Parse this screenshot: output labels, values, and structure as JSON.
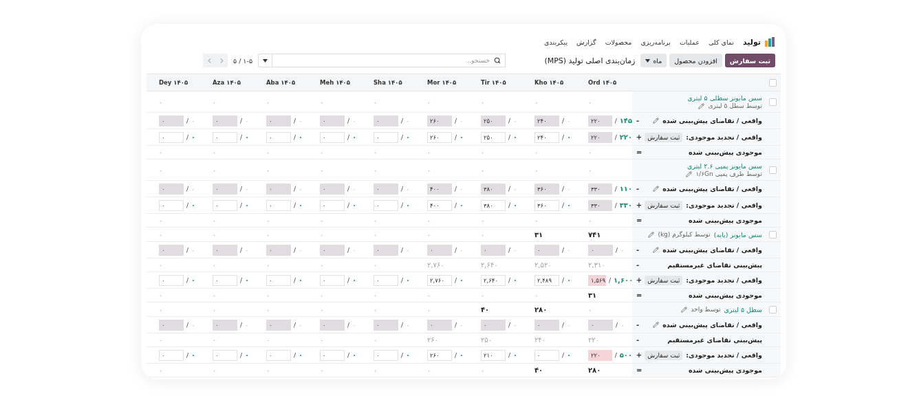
{
  "app": {
    "name": "تولید",
    "menu": [
      "نمای کلی",
      "عملیات",
      "برنامه‌ریزی",
      "محصولات",
      "گزارش",
      "پیکربندی"
    ]
  },
  "toolbar": {
    "buttons": [
      {
        "label": "ثبت سفارش",
        "kind": "primary"
      },
      {
        "label": "افزودن محصول",
        "kind": "secondary"
      }
    ],
    "period": "ماه",
    "title": "زمان‌بندی اصلی تولید (MPS)",
    "search": {
      "placeholder": "جستجو..."
    },
    "pager": "۱-۵ / ۵"
  },
  "table": {
    "select_all": {
      "checked": false
    },
    "columns": [
      "Ord ۱۴۰۵",
      "Kho ۱۴۰۵",
      "Tir ۱۴۰۵",
      "Mor ۱۴۰۵",
      "Sha ۱۴۰۵",
      "Meh ۱۴۰۵",
      "Aba ۱۴۰۵",
      "Aza ۱۴۰۵",
      "Dey ۱۴۰۵"
    ],
    "rows": [
      {
        "kind": "product_stacked",
        "checked": false,
        "name": "سس مایونز سطلی ۵ لیتری",
        "sub": "توسط سطل ۵ لیتری",
        "cells": [
          {
            "text": "۰",
            "highlighted": false
          },
          {
            "text": "۰",
            "highlighted": false
          },
          {
            "text": "۰",
            "highlighted": false
          },
          {
            "text": "۰",
            "highlighted": false
          },
          {
            "text": "۰",
            "highlighted": false
          },
          {
            "text": "۰",
            "highlighted": false
          },
          {
            "text": "۰",
            "highlighted": false
          },
          {
            "text": "۰",
            "highlighted": false
          },
          {
            "text": "۰",
            "highlighted": false
          }
        ]
      },
      {
        "kind": "demand",
        "sign": "-",
        "label": "واقعی / تقاضای پیش‌بینی شده",
        "cells": [
          {
            "kind": "filled",
            "value": "۲۲۰",
            "sep": "/",
            "actual": "۱۴۵",
            "highlighted": true
          },
          {
            "kind": "filled",
            "value": "۲۴۰",
            "sep": "/",
            "actual": "۰",
            "highlighted": false
          },
          {
            "kind": "filled",
            "value": "۲۵۰",
            "sep": "/",
            "actual": "۰",
            "highlighted": false
          },
          {
            "kind": "filled",
            "value": "۲۶۰",
            "sep": "/",
            "actual": "۰",
            "highlighted": false
          },
          {
            "kind": "filled",
            "value": "۰",
            "sep": "/",
            "actual": "۰",
            "highlighted": false
          },
          {
            "kind": "filled",
            "value": "۰",
            "sep": "/",
            "actual": "۰",
            "highlighted": false
          },
          {
            "kind": "filled",
            "value": "۰",
            "sep": "/",
            "actual": "۰",
            "highlighted": false
          },
          {
            "kind": "filled",
            "value": "۰",
            "sep": "/",
            "actual": "۰",
            "highlighted": false
          },
          {
            "kind": "filled",
            "value": "۰",
            "sep": "/",
            "actual": "۰",
            "highlighted": false
          }
        ]
      },
      {
        "kind": "replenish",
        "sign": "+",
        "label": "واقعی / تجدید موجودی:",
        "button": "ثبت سفارش",
        "cells": [
          {
            "kind": "filled",
            "value": "۲۲۰",
            "sep": "/",
            "actual": "۲۲۰",
            "highlighted": true
          },
          {
            "kind": "input",
            "value": "۲۴۰",
            "sep": "/",
            "actual": "۰",
            "highlighted": true
          },
          {
            "kind": "input",
            "value": "۲۵۰",
            "sep": "/",
            "actual": "۰",
            "highlighted": true
          },
          {
            "kind": "input",
            "value": "۲۶۰",
            "sep": "/",
            "actual": "۰",
            "highlighted": true
          },
          {
            "kind": "input",
            "value": "۰",
            "sep": "/",
            "actual": "۰",
            "highlighted": true
          },
          {
            "kind": "input",
            "value": "۰",
            "sep": "/",
            "actual": "۰",
            "highlighted": true
          },
          {
            "kind": "input",
            "value": "۰",
            "sep": "/",
            "actual": "۰",
            "highlighted": true
          },
          {
            "kind": "input",
            "value": "۰",
            "sep": "/",
            "actual": "۰",
            "highlighted": true
          },
          {
            "kind": "input",
            "value": "۰",
            "sep": "/",
            "actual": "۰",
            "highlighted": true
          }
        ]
      },
      {
        "kind": "plain",
        "sign": "=",
        "label": "موجودی پیش‌بینی شده",
        "cells": [
          {
            "text": "۰",
            "highlighted": false
          },
          {
            "text": "۰",
            "highlighted": false
          },
          {
            "text": "۰",
            "highlighted": false
          },
          {
            "text": "۰",
            "highlighted": false
          },
          {
            "text": "۰",
            "highlighted": false
          },
          {
            "text": "۰",
            "highlighted": false
          },
          {
            "text": "۰",
            "highlighted": false
          },
          {
            "text": "۰",
            "highlighted": false
          },
          {
            "text": "۰",
            "highlighted": false
          }
        ]
      },
      {
        "kind": "product_stacked",
        "checked": false,
        "name": "سس مایونز پمپی ۲.۶ لیتری",
        "sub": "توسط ظرف پمپی ۱/۶Gn",
        "cells": [
          {
            "text": "۰",
            "highlighted": false
          },
          {
            "text": "۰",
            "highlighted": false
          },
          {
            "text": "۰",
            "highlighted": false
          },
          {
            "text": "۰",
            "highlighted": false
          },
          {
            "text": "۰",
            "highlighted": false
          },
          {
            "text": "۰",
            "highlighted": false
          },
          {
            "text": "۰",
            "highlighted": false
          },
          {
            "text": "۰",
            "highlighted": false
          },
          {
            "text": "۰",
            "highlighted": false
          }
        ]
      },
      {
        "kind": "demand",
        "sign": "-",
        "label": "واقعی / تقاضای پیش‌بینی شده",
        "cells": [
          {
            "kind": "filled",
            "value": "۳۳۰",
            "sep": "/",
            "actual": "۱۱۰",
            "highlighted": true
          },
          {
            "kind": "filled",
            "value": "۳۶۰",
            "sep": "/",
            "actual": "۰",
            "highlighted": false
          },
          {
            "kind": "filled",
            "value": "۳۸۰",
            "sep": "/",
            "actual": "۰",
            "highlighted": false
          },
          {
            "kind": "filled",
            "value": "۴۰۰",
            "sep": "/",
            "actual": "۰",
            "highlighted": false
          },
          {
            "kind": "filled",
            "value": "۰",
            "sep": "/",
            "actual": "۰",
            "highlighted": false
          },
          {
            "kind": "filled",
            "value": "۰",
            "sep": "/",
            "actual": "۰",
            "highlighted": false
          },
          {
            "kind": "filled",
            "value": "۰",
            "sep": "/",
            "actual": "۰",
            "highlighted": false
          },
          {
            "kind": "filled",
            "value": "۰",
            "sep": "/",
            "actual": "۰",
            "highlighted": false
          },
          {
            "kind": "filled",
            "value": "۰",
            "sep": "/",
            "actual": "۰",
            "highlighted": false
          }
        ]
      },
      {
        "kind": "replenish",
        "sign": "+",
        "label": "واقعی / تجدید موجودی:",
        "button": "ثبت سفارش",
        "cells": [
          {
            "kind": "filled",
            "value": "۳۳۰",
            "sep": "/",
            "actual": "۳۳۰",
            "highlighted": true
          },
          {
            "kind": "input",
            "value": "۳۶۰",
            "sep": "/",
            "actual": "۰",
            "highlighted": true
          },
          {
            "kind": "input",
            "value": "۳۸۰",
            "sep": "/",
            "actual": "۰",
            "highlighted": true
          },
          {
            "kind": "input",
            "value": "۴۰۰",
            "sep": "/",
            "actual": "۰",
            "highlighted": true
          },
          {
            "kind": "input",
            "value": "۰",
            "sep": "/",
            "actual": "۰",
            "highlighted": true
          },
          {
            "kind": "input",
            "value": "۰",
            "sep": "/",
            "actual": "۰",
            "highlighted": true
          },
          {
            "kind": "input",
            "value": "۰",
            "sep": "/",
            "actual": "۰",
            "highlighted": true
          },
          {
            "kind": "input",
            "value": "۰",
            "sep": "/",
            "actual": "۰",
            "highlighted": true
          },
          {
            "kind": "input",
            "value": "۰",
            "sep": "/",
            "actual": "۰",
            "highlighted": true
          }
        ]
      },
      {
        "kind": "plain",
        "sign": "=",
        "label": "موجودی پیش‌بینی شده",
        "cells": [
          {
            "text": "۰",
            "highlighted": false
          },
          {
            "text": "۰",
            "highlighted": false
          },
          {
            "text": "۰",
            "highlighted": false
          },
          {
            "text": "۰",
            "highlighted": false
          },
          {
            "text": "۰",
            "highlighted": false
          },
          {
            "text": "۰",
            "highlighted": false
          },
          {
            "text": "۰",
            "highlighted": false
          },
          {
            "text": "۰",
            "highlighted": false
          },
          {
            "text": "۰",
            "highlighted": false
          }
        ]
      },
      {
        "kind": "product_inline",
        "checked": false,
        "name": "سس مایونز (پایه)",
        "sub": "توسط کیلوگرم (kg)",
        "cells": [
          {
            "text": "۷۴۱",
            "highlighted": true
          },
          {
            "text": "۳۱",
            "highlighted": true
          },
          {
            "text": "۰",
            "highlighted": false
          },
          {
            "text": "۰",
            "highlighted": false
          },
          {
            "text": "۰",
            "highlighted": false
          },
          {
            "text": "۰",
            "highlighted": false
          },
          {
            "text": "۰",
            "highlighted": false
          },
          {
            "text": "۰",
            "highlighted": false
          },
          {
            "text": "۰",
            "highlighted": false
          }
        ]
      },
      {
        "kind": "demand",
        "sign": "-",
        "label": "واقعی / تقاضای پیش‌بینی شده",
        "cells": [
          {
            "kind": "filled",
            "value": "۰",
            "sep": "/",
            "actual": "۰",
            "highlighted": false
          },
          {
            "kind": "filled",
            "value": "۰",
            "sep": "/",
            "actual": "۰",
            "highlighted": false
          },
          {
            "kind": "filled",
            "value": "۰",
            "sep": "/",
            "actual": "۰",
            "highlighted": false
          },
          {
            "kind": "filled",
            "value": "۰",
            "sep": "/",
            "actual": "۰",
            "highlighted": false
          },
          {
            "kind": "filled",
            "value": "۰",
            "sep": "/",
            "actual": "۰",
            "highlighted": false
          },
          {
            "kind": "filled",
            "value": "۰",
            "sep": "/",
            "actual": "۰",
            "highlighted": false
          },
          {
            "kind": "filled",
            "value": "۰",
            "sep": "/",
            "actual": "۰",
            "highlighted": false
          },
          {
            "kind": "filled",
            "value": "۰",
            "sep": "/",
            "actual": "۰",
            "highlighted": false
          },
          {
            "kind": "filled",
            "value": "۰",
            "sep": "/",
            "actual": "۰",
            "highlighted": false
          }
        ]
      },
      {
        "kind": "plain",
        "sign": "-",
        "label": "پیش‌بینی تقاضای غیرمستقیم",
        "cells": [
          {
            "text": "۲,۳۱۰",
            "highlighted": false
          },
          {
            "text": "۲,۵۲۰",
            "highlighted": false
          },
          {
            "text": "۲,۶۴۰",
            "highlighted": false
          },
          {
            "text": "۲,۷۶۰",
            "highlighted": false
          },
          {
            "text": "۰",
            "highlighted": false
          },
          {
            "text": "۰",
            "highlighted": false
          },
          {
            "text": "۰",
            "highlighted": false
          },
          {
            "text": "۰",
            "highlighted": false
          },
          {
            "text": "۰",
            "highlighted": false
          }
        ]
      },
      {
        "kind": "replenish",
        "sign": "+",
        "label": "واقعی / تجدید موجودی:",
        "button": "ثبت سفارش",
        "cells": [
          {
            "kind": "warning",
            "value": "۱,۵۶۹",
            "sep": "/",
            "actual": "۱,۶۰۰",
            "highlighted": true
          },
          {
            "kind": "input",
            "value": "۲,۴۸۹",
            "sep": "/",
            "actual": "۰",
            "highlighted": true
          },
          {
            "kind": "input",
            "value": "۲,۶۴۰",
            "sep": "/",
            "actual": "۰",
            "highlighted": true
          },
          {
            "kind": "input",
            "value": "۲,۷۶۰",
            "sep": "/",
            "actual": "۰",
            "highlighted": true
          },
          {
            "kind": "input",
            "value": "۰",
            "sep": "/",
            "actual": "۰",
            "highlighted": true
          },
          {
            "kind": "input",
            "value": "۰",
            "sep": "/",
            "actual": "۰",
            "highlighted": true
          },
          {
            "kind": "input",
            "value": "۰",
            "sep": "/",
            "actual": "۰",
            "highlighted": true
          },
          {
            "kind": "input",
            "value": "۰",
            "sep": "/",
            "actual": "۰",
            "highlighted": true
          },
          {
            "kind": "input",
            "value": "۰",
            "sep": "/",
            "actual": "۰",
            "highlighted": true
          }
        ]
      },
      {
        "kind": "plain",
        "sign": "=",
        "label": "موجودی پیش‌بینی شده",
        "cells": [
          {
            "text": "۳۱",
            "highlighted": true
          },
          {
            "text": "۰",
            "highlighted": false
          },
          {
            "text": "۰",
            "highlighted": false
          },
          {
            "text": "۰",
            "highlighted": false
          },
          {
            "text": "۰",
            "highlighted": false
          },
          {
            "text": "۰",
            "highlighted": false
          },
          {
            "text": "۰",
            "highlighted": false
          },
          {
            "text": "۰",
            "highlighted": false
          },
          {
            "text": "۰",
            "highlighted": false
          }
        ]
      },
      {
        "kind": "product_inline",
        "checked": false,
        "name": "سطل ۵ لیتری",
        "sub": "توسط واحد",
        "cells": [
          {
            "text": "۰",
            "highlighted": false
          },
          {
            "text": "۲۸۰",
            "highlighted": true
          },
          {
            "text": "۴۰",
            "highlighted": true
          },
          {
            "text": "۰",
            "highlighted": false
          },
          {
            "text": "۰",
            "highlighted": false
          },
          {
            "text": "۰",
            "highlighted": false
          },
          {
            "text": "۰",
            "highlighted": false
          },
          {
            "text": "۰",
            "highlighted": false
          },
          {
            "text": "۰",
            "highlighted": false
          }
        ]
      },
      {
        "kind": "demand",
        "sign": "-",
        "label": "واقعی / تقاضای پیش‌بینی شده",
        "cells": [
          {
            "kind": "filled",
            "value": "۰",
            "sep": "/",
            "actual": "۰",
            "highlighted": false
          },
          {
            "kind": "filled",
            "value": "۰",
            "sep": "/",
            "actual": "۰",
            "highlighted": false
          },
          {
            "kind": "filled",
            "value": "۰",
            "sep": "/",
            "actual": "۰",
            "highlighted": false
          },
          {
            "kind": "filled",
            "value": "۰",
            "sep": "/",
            "actual": "۰",
            "highlighted": false
          },
          {
            "kind": "filled",
            "value": "۰",
            "sep": "/",
            "actual": "۰",
            "highlighted": false
          },
          {
            "kind": "filled",
            "value": "۰",
            "sep": "/",
            "actual": "۰",
            "highlighted": false
          },
          {
            "kind": "filled",
            "value": "۰",
            "sep": "/",
            "actual": "۰",
            "highlighted": false
          },
          {
            "kind": "filled",
            "value": "۰",
            "sep": "/",
            "actual": "۰",
            "highlighted": false
          },
          {
            "kind": "filled",
            "value": "۰",
            "sep": "/",
            "actual": "۰",
            "highlighted": false
          }
        ]
      },
      {
        "kind": "plain",
        "sign": "-",
        "label": "پیش‌بینی تقاضای غیرمستقیم",
        "cells": [
          {
            "text": "۲۲۰",
            "highlighted": false
          },
          {
            "text": "۲۴۰",
            "highlighted": false
          },
          {
            "text": "۲۵۰",
            "highlighted": false
          },
          {
            "text": "۲۶۰",
            "highlighted": false
          },
          {
            "text": "۰",
            "highlighted": false
          },
          {
            "text": "۰",
            "highlighted": false
          },
          {
            "text": "۰",
            "highlighted": false
          },
          {
            "text": "۰",
            "highlighted": false
          },
          {
            "text": "۰",
            "highlighted": false
          }
        ]
      },
      {
        "kind": "replenish",
        "sign": "+",
        "label": "واقعی / تجدید موجودی:",
        "button": "ثبت سفارش",
        "cells": [
          {
            "kind": "warning",
            "value": "۲۲۰",
            "sep": "/",
            "actual": "۵۰۰",
            "highlighted": true
          },
          {
            "kind": "input",
            "value": "۰",
            "sep": "/",
            "actual": "۰",
            "highlighted": true
          },
          {
            "kind": "input",
            "value": "۲۱۰",
            "sep": "/",
            "actual": "۰",
            "highlighted": true
          },
          {
            "kind": "input",
            "value": "۲۶۰",
            "sep": "/",
            "actual": "۰",
            "highlighted": true
          },
          {
            "kind": "input",
            "value": "۰",
            "sep": "/",
            "actual": "۰",
            "highlighted": true
          },
          {
            "kind": "input",
            "value": "۰",
            "sep": "/",
            "actual": "۰",
            "highlighted": true
          },
          {
            "kind": "input",
            "value": "۰",
            "sep": "/",
            "actual": "۰",
            "highlighted": true
          },
          {
            "kind": "input",
            "value": "۰",
            "sep": "/",
            "actual": "۰",
            "highlighted": true
          },
          {
            "kind": "input",
            "value": "۰",
            "sep": "/",
            "actual": "۰",
            "highlighted": true
          }
        ]
      },
      {
        "kind": "plain",
        "sign": "=",
        "label": "موجودی پیش‌بینی شده",
        "cells": [
          {
            "text": "۲۸۰",
            "highlighted": true
          },
          {
            "text": "۴۰",
            "highlighted": true
          },
          {
            "text": "۰",
            "highlighted": false
          },
          {
            "text": "۰",
            "highlighted": false
          },
          {
            "text": "۰",
            "highlighted": false
          },
          {
            "text": "۰",
            "highlighted": false
          },
          {
            "text": "۰",
            "highlighted": false
          },
          {
            "text": "۰",
            "highlighted": false
          },
          {
            "text": "۰",
            "highlighted": false
          }
        ]
      }
    ]
  }
}
